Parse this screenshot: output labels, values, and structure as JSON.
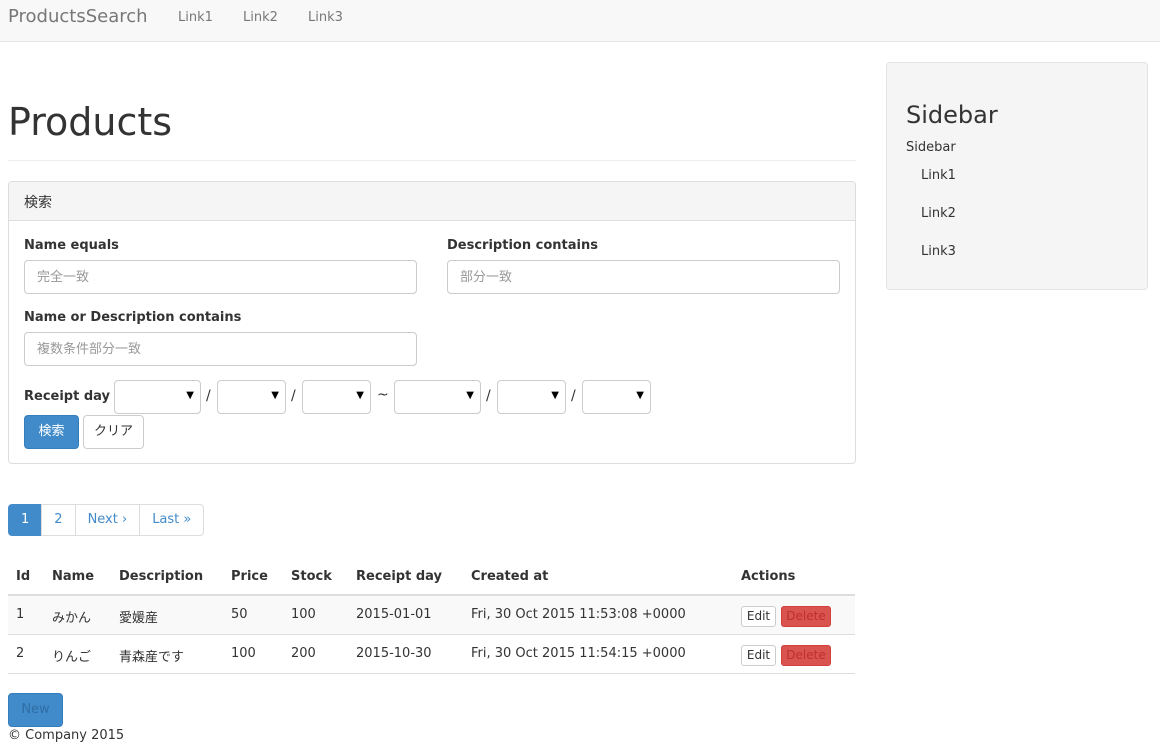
{
  "navbar": {
    "brand": "ProductsSearch",
    "links": [
      "Link1",
      "Link2",
      "Link3"
    ]
  },
  "page": {
    "title": "Products"
  },
  "search": {
    "heading": "検索",
    "name_equals_label": "Name equals",
    "name_equals_placeholder": "完全一致",
    "description_contains_label": "Description contains",
    "description_contains_placeholder": "部分一致",
    "name_or_desc_label": "Name or Description contains",
    "name_or_desc_placeholder": "複数条件部分一致",
    "receipt_day_label": "Receipt day",
    "date_sep": "/",
    "range_sep": "~",
    "search_button": "検索",
    "clear_button": "クリア"
  },
  "pagination": [
    "1",
    "2",
    "Next ›",
    "Last »"
  ],
  "table": {
    "headers": [
      "Id",
      "Name",
      "Description",
      "Price",
      "Stock",
      "Receipt day",
      "Created at",
      "Actions"
    ],
    "rows": [
      [
        "1",
        "みかん",
        "愛媛産",
        "50",
        "100",
        "2015-01-01",
        "Fri, 30 Oct 2015 11:53:08 +0000"
      ],
      [
        "2",
        "りんご",
        "青森産です",
        "100",
        "200",
        "2015-10-30",
        "Fri, 30 Oct 2015 11:54:15 +0000"
      ]
    ],
    "edit_label": "Edit",
    "delete_label": "Delete"
  },
  "new_button": "New",
  "footer": "© Company 2015",
  "sidebar": {
    "title": "Sidebar",
    "subtitle": "Sidebar",
    "links": [
      "Link1",
      "Link2",
      "Link3"
    ]
  }
}
